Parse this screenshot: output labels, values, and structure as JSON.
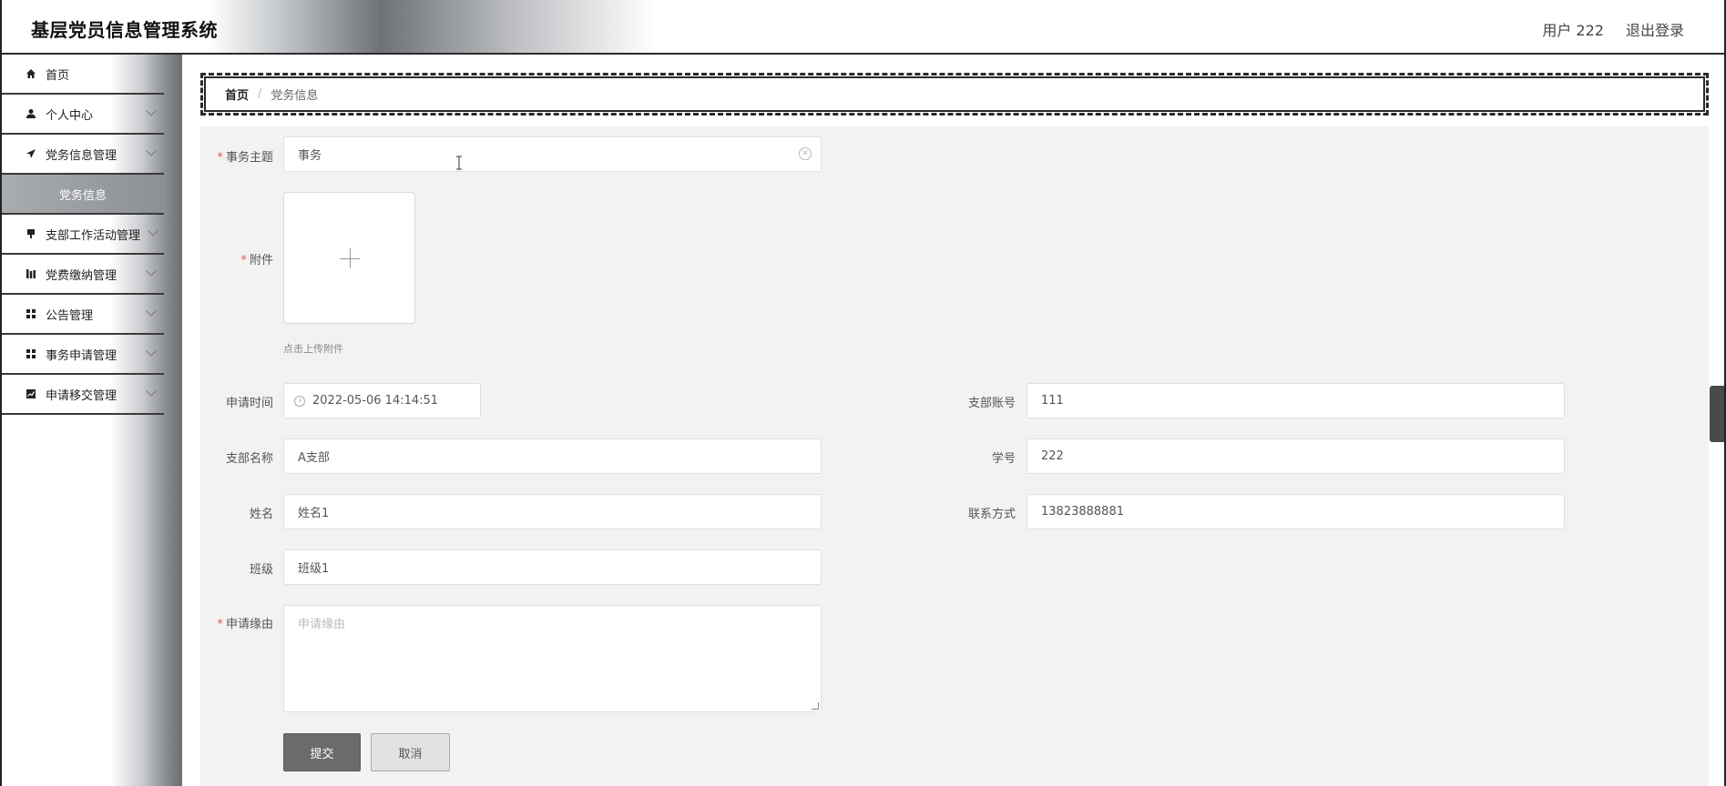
{
  "header": {
    "app_title": "基层党员信息管理系统",
    "user_label": "用户 222",
    "logout_label": "退出登录"
  },
  "sidebar": {
    "items": [
      {
        "label": "首页",
        "icon": "home-icon"
      },
      {
        "label": "个人中心",
        "icon": "user-icon"
      },
      {
        "label": "党务信息管理",
        "icon": "send-icon"
      },
      {
        "label": "党务信息",
        "icon": ""
      },
      {
        "label": "支部工作活动管理",
        "icon": "flag-icon"
      },
      {
        "label": "党费缴纳管理",
        "icon": "bars-icon"
      },
      {
        "label": "公告管理",
        "icon": "grid-icon"
      },
      {
        "label": "事务申请管理",
        "icon": "grid-icon"
      },
      {
        "label": "申请移交管理",
        "icon": "chart-icon"
      }
    ]
  },
  "breadcrumb": {
    "home": "首页",
    "separator": "/",
    "current": "党务信息"
  },
  "form": {
    "subject": {
      "label": "事务主题",
      "value": "事务"
    },
    "attachment": {
      "label": "附件",
      "hint": "点击上传附件"
    },
    "apply_time": {
      "label": "申请时间",
      "value": "2022-05-06 14:14:51"
    },
    "branch_account": {
      "label": "支部账号",
      "value": "111"
    },
    "branch_name": {
      "label": "支部名称",
      "value": "A支部"
    },
    "student_id": {
      "label": "学号",
      "value": "222"
    },
    "name": {
      "label": "姓名",
      "value": "姓名1"
    },
    "contact": {
      "label": "联系方式",
      "value": "13823888881"
    },
    "class": {
      "label": "班级",
      "value": "班级1"
    },
    "reason": {
      "label": "申请缘由",
      "placeholder": "申请缘由"
    },
    "submit_label": "提交",
    "cancel_label": "取消",
    "required_mark": "*"
  },
  "colors": {
    "required": "#e05a5a",
    "primary_button": "#6b6b6b",
    "form_bg": "#f2f2f2"
  }
}
